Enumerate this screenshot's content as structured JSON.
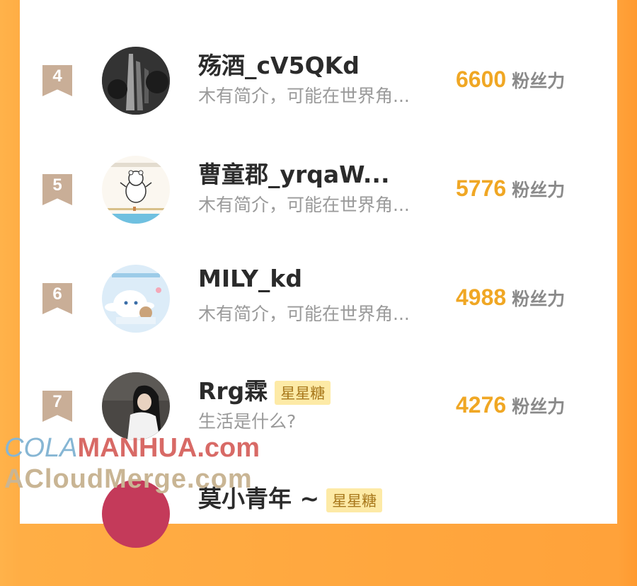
{
  "colors": {
    "accent_score": "#f0a724",
    "rank_badge": "#c9ae97",
    "vip_badge_bg": "#fdeaa6",
    "background_orange": "#ffa23a"
  },
  "rows": [
    {
      "rank": "4",
      "name": "殇酒_cV5QKd",
      "badge": "",
      "bio": "木有简介，可能在世界角...",
      "score": "6600",
      "unit": "粉丝力",
      "avatar": "waterfall-avatar"
    },
    {
      "rank": "5",
      "name": "曹童郡_yrqaW...",
      "badge": "",
      "bio": "木有简介，可能在世界角...",
      "score": "5776",
      "unit": "粉丝力",
      "avatar": "polar-bear-avatar"
    },
    {
      "rank": "6",
      "name": "MILY_kd",
      "badge": "",
      "bio": "木有简介，可能在世界角...",
      "score": "4988",
      "unit": "粉丝力",
      "avatar": "cinnamoroll-avatar"
    },
    {
      "rank": "7",
      "name": "Rrg霖",
      "badge": "星星糖",
      "bio": "生活是什么?",
      "score": "4276",
      "unit": "粉丝力",
      "avatar": "girl-photo-avatar"
    }
  ],
  "partial_next_row": {
    "name": "莫小青年 ~",
    "badge": "星星糖"
  },
  "watermark": {
    "line1_a": "COLA",
    "line1_b": "MANHUA.com",
    "line2": "ACloudMerge.com"
  }
}
